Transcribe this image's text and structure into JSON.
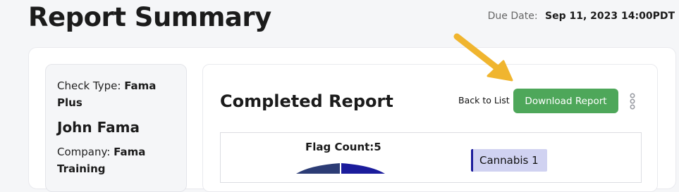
{
  "page": {
    "title": "Report Summary",
    "due_label": "Due Date:",
    "due_value": "Sep 11, 2023 14:00PDT"
  },
  "sidebar": {
    "check_type_label": "Check Type: ",
    "check_type_value": "Fama Plus",
    "person_name": "John Fama",
    "company_label": "Company: ",
    "company_value": "Fama Training"
  },
  "report": {
    "title": "Completed Report",
    "back_link": "Back to List",
    "download_button": "Download Report",
    "more_icon": "more-vertical-icon",
    "callout_icon": "arrow-pointer-icon"
  },
  "colors": {
    "download_button": "#4ea75a",
    "callout_arrow": "#f0b52f",
    "legend_chip_bg": "#d0d2f1",
    "legend_chip_accent": "#1b1c9c",
    "pie_segment_1": "#2c3c75",
    "pie_segment_2": "#1b1c9c"
  },
  "chart_data": {
    "type": "pie",
    "title": "Flag Count:5",
    "legend": [
      "Cannabis 1"
    ]
  }
}
